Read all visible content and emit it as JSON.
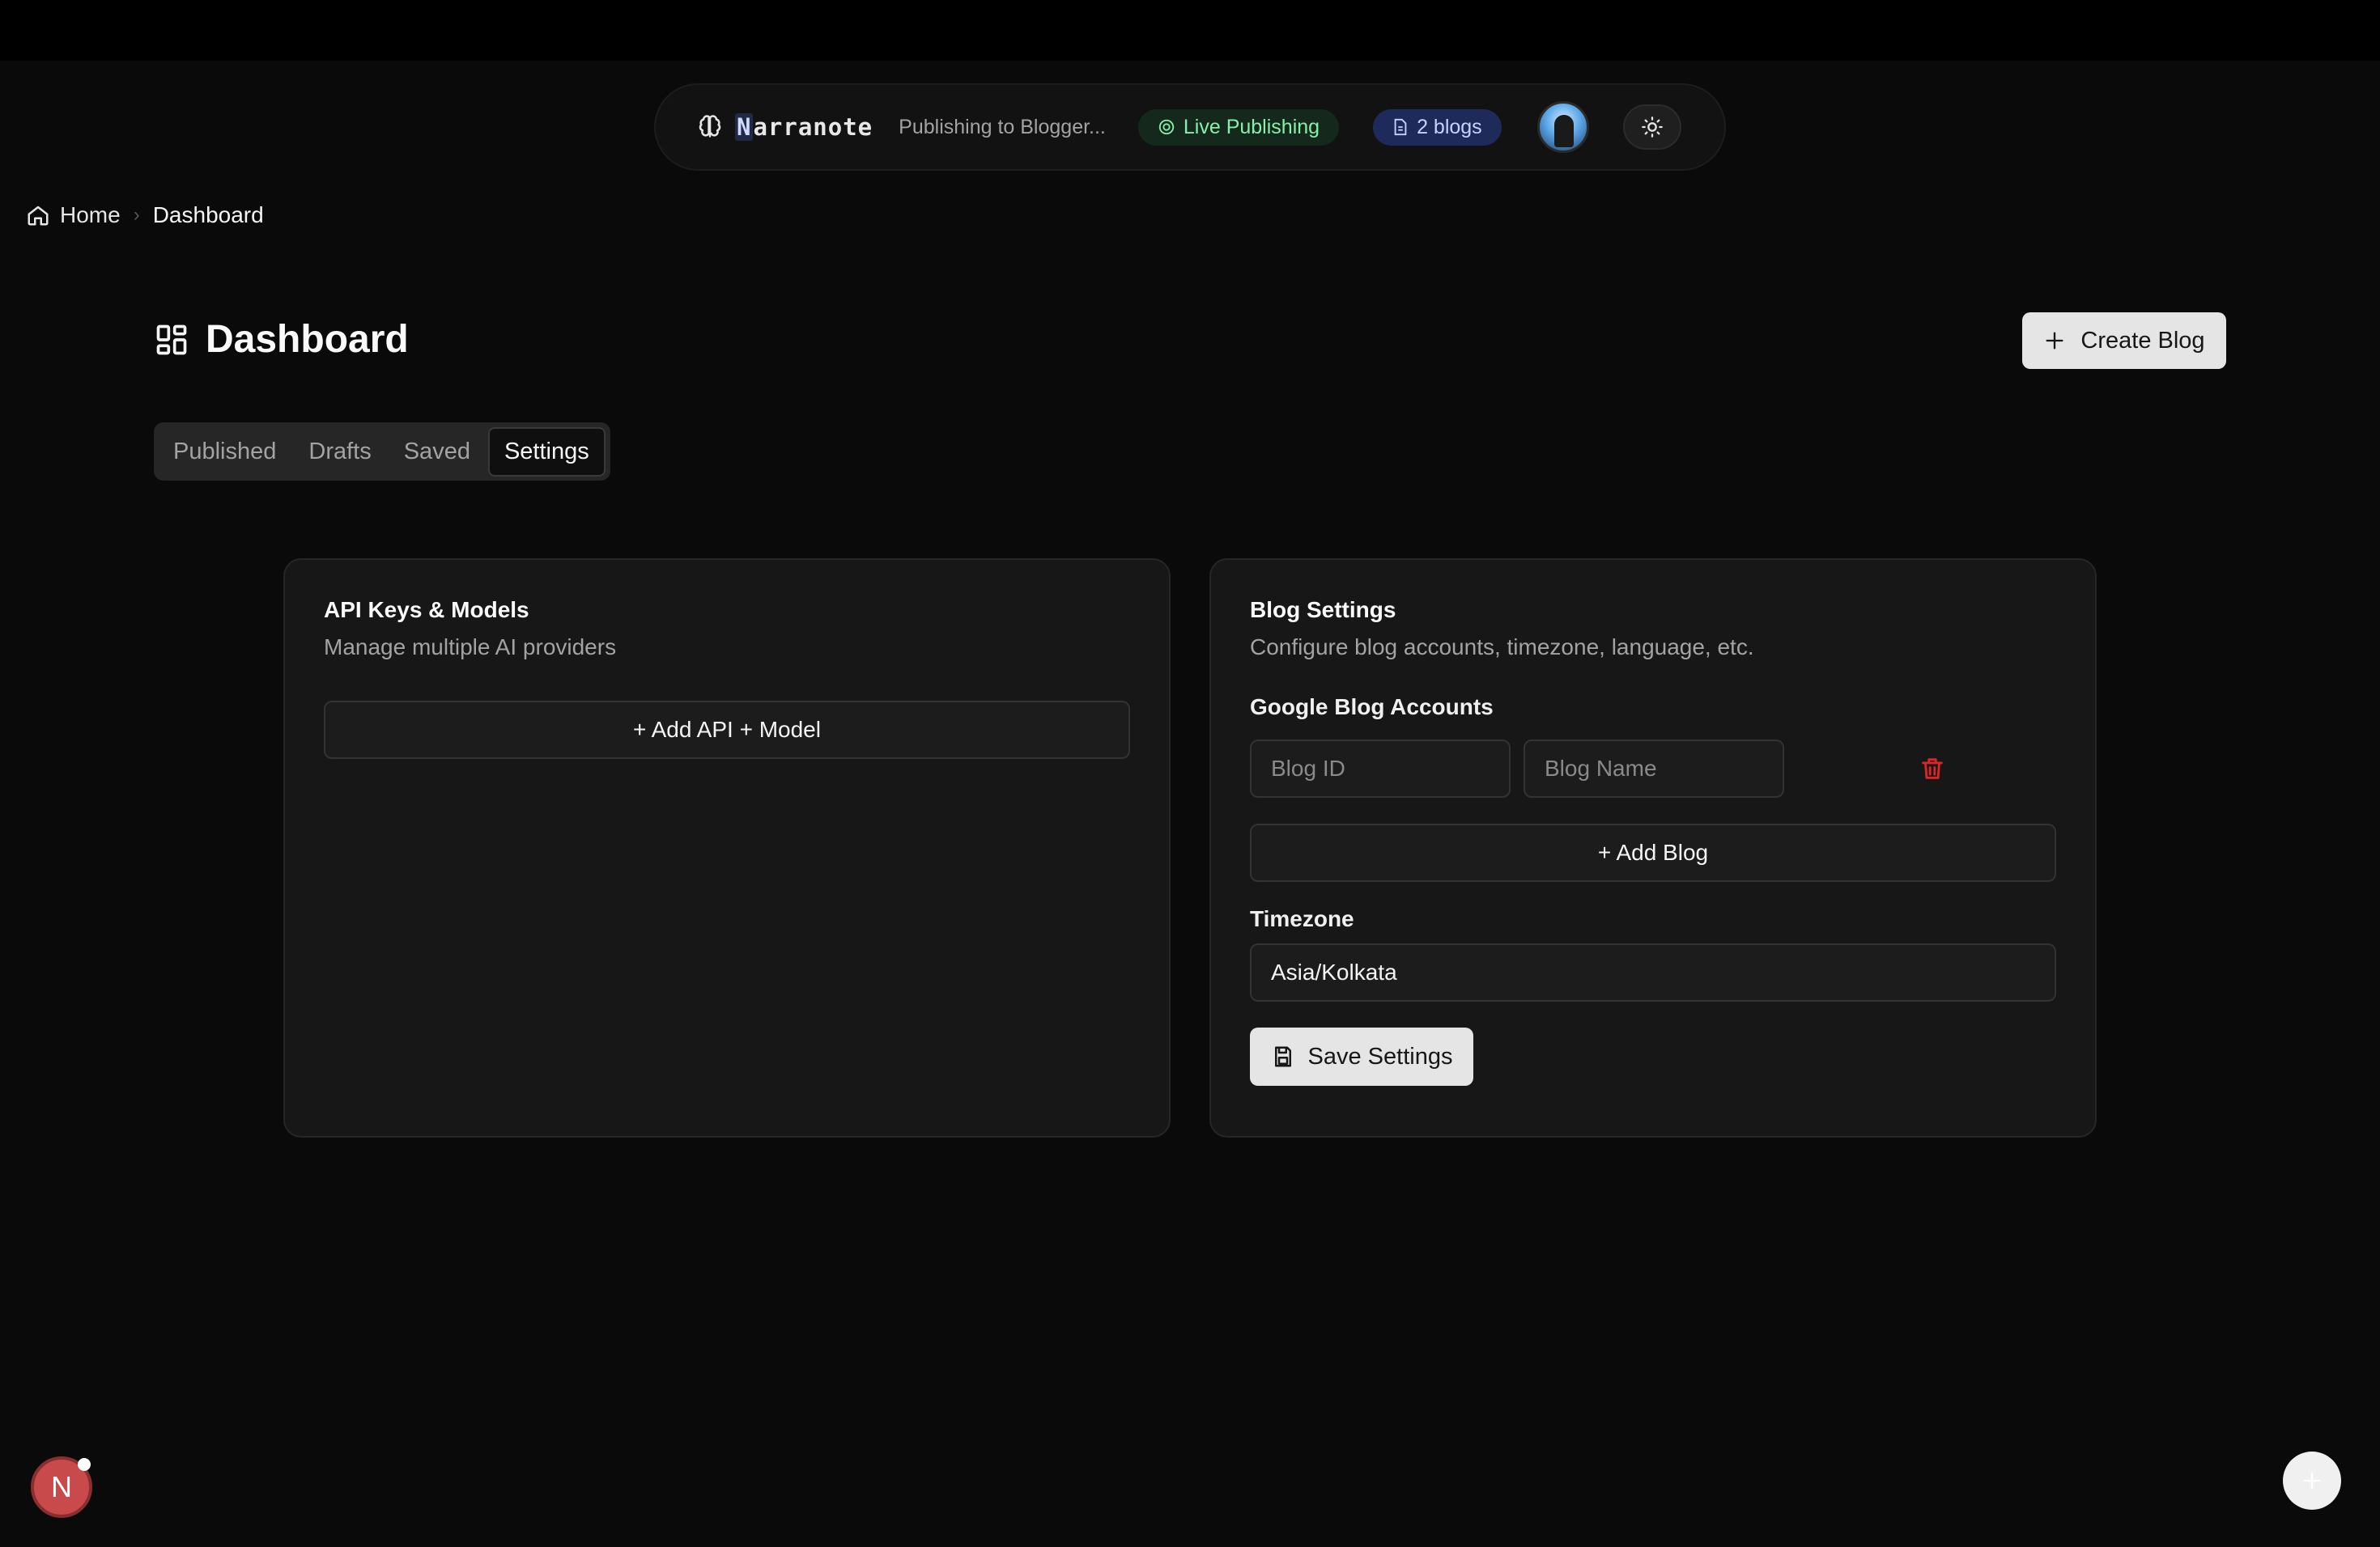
{
  "header": {
    "brand_first_letter": "N",
    "brand_rest": "arranote",
    "publishing_status": "Publishing to Blogger...",
    "live_badge": "Live Publishing",
    "blogs_badge": "2 blogs"
  },
  "breadcrumb": {
    "home": "Home",
    "current": "Dashboard"
  },
  "page": {
    "title": "Dashboard",
    "create_button": "Create Blog"
  },
  "tabs": [
    {
      "label": "Published",
      "active": false
    },
    {
      "label": "Drafts",
      "active": false
    },
    {
      "label": "Saved",
      "active": false
    },
    {
      "label": "Settings",
      "active": true
    }
  ],
  "api_card": {
    "title": "API Keys & Models",
    "description": "Manage multiple AI providers",
    "add_button": "+ Add API + Model"
  },
  "blog_card": {
    "title": "Blog Settings",
    "description": "Configure blog accounts, timezone, language, etc.",
    "accounts_label": "Google Blog Accounts",
    "blog_id_placeholder": "Blog ID",
    "blog_name_placeholder": "Blog Name",
    "add_blog_button": "+ Add Blog",
    "timezone_label": "Timezone",
    "timezone_value": "Asia/Kolkata",
    "save_button": "Save Settings"
  },
  "dev_badge": "N",
  "colors": {
    "background": "#0a0a0a",
    "card": "#171717",
    "live_green": "#86efac",
    "blogs_blue": "#c7d2fe",
    "danger_red": "#dc2626"
  }
}
